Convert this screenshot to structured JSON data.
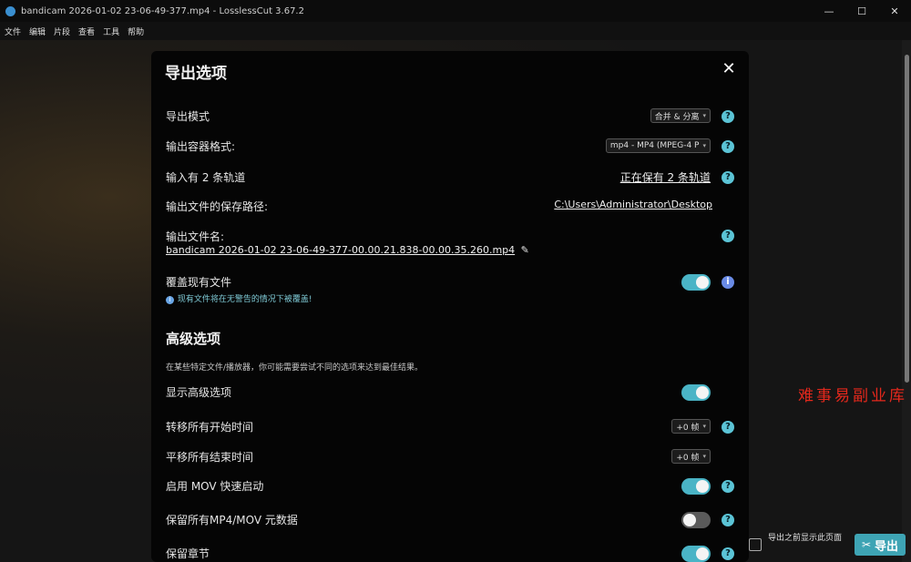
{
  "window": {
    "title": "bandicam 2026-01-02 23-06-49-377.mp4 - LosslessCut 3.67.2",
    "minimize_glyph": "—",
    "maximize_glyph": "☐",
    "close_glyph": "✕"
  },
  "menu": [
    "文件",
    "编辑",
    "片段",
    "查看",
    "工具",
    "帮助"
  ],
  "dialog": {
    "title": "导出选项",
    "close_glyph": "✕",
    "export_mode": {
      "label": "导出模式",
      "value": "合并 & 分离"
    },
    "container_format": {
      "label": "输出容器格式:",
      "value": "mp4 - MP4 (MPEG-4 P"
    },
    "tracks": {
      "label": "输入有 2 条轨道",
      "value": "正在保有 2 条轨道"
    },
    "output_path": {
      "label": "输出文件的保存路径:",
      "value": "C:\\Users\\Administrator\\Desktop"
    },
    "output_filename": {
      "label": "输出文件名:",
      "value": "bandicam 2026-01-02 23-06-49-377-00.00.21.838-00.00.35.260.mp4"
    },
    "overwrite": {
      "label": "覆盖现有文件",
      "on": true,
      "note": "现有文件将在无警告的情况下被覆盖!"
    },
    "advanced": {
      "title": "高级选项",
      "description": "在某些特定文件/播放器，你可能需要尝试不同的选项来达到最佳结果。",
      "show_advanced": {
        "label": "显示高级选项",
        "on": true
      },
      "shift_start": {
        "label": "转移所有开始时间",
        "value": "+0 帧"
      },
      "shift_end": {
        "label": "平移所有结束时间",
        "value": "+0 帧"
      },
      "mov_faststart": {
        "label": "启用 MOV 快速启动",
        "on": true
      },
      "preserve_metadata": {
        "label": "保留所有MP4/MOV 元数据",
        "on": false
      },
      "preserve_chapters": {
        "label": "保留章节",
        "on": true
      }
    }
  },
  "bottom": {
    "show_before_export": "导出之前显示此页面",
    "export_label": "导出"
  },
  "watermark": "难事易副业库",
  "colors": {
    "accent": "#4ab4c6",
    "help": "#5bc4d6",
    "watermark": "#e4281c"
  },
  "icons": {
    "help": "?",
    "info": "i",
    "edit": "✎",
    "caret": "▾",
    "scissors": "✂"
  }
}
